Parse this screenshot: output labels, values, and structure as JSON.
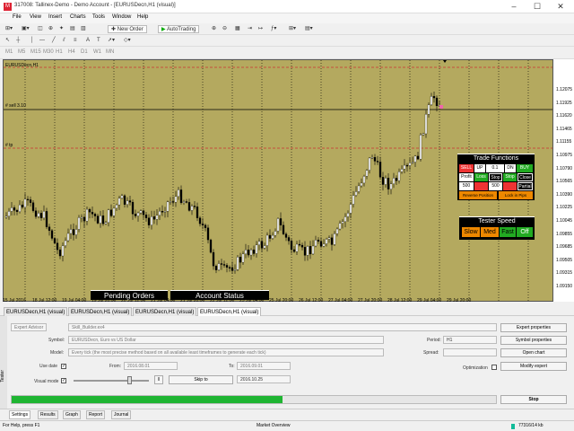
{
  "window": {
    "title": "317008: Tallinex-Demo - Demo Account - [EURUSDecn,H1 (visual)]",
    "logo": "M"
  },
  "menu": [
    "File",
    "View",
    "Insert",
    "Charts",
    "Tools",
    "Window",
    "Help"
  ],
  "toolbar": {
    "new_order": "New Order",
    "autotrading": "AutoTrading"
  },
  "timeframes": [
    "M1",
    "M5",
    "M15",
    "M30",
    "H1",
    "H4",
    "D1",
    "W1",
    "MN"
  ],
  "chart": {
    "symbol_label": "EURUSDecn,H1",
    "sell_label": "# sell 3.10",
    "tp_label": "# tp",
    "price_labels": [
      "1.12075",
      "1.11925",
      "1.11620",
      "1.11465",
      "1.11155",
      "1.10975",
      "1.10790",
      "1.10565",
      "1.10390",
      "1.10225",
      "1.10045",
      "1.09855",
      "1.09685",
      "1.09505",
      "1.09315",
      "1.09150"
    ],
    "time_labels": [
      "15 Jul 2016",
      "18 Jul 12:00",
      "19 Jul 04:00",
      "19 Jul 20:00",
      "20 Jul 12:00",
      "21 Jul 04:00",
      "21 Jul 20:00",
      "22 Jul 12:00",
      "25 Jul 04:00",
      "25 Jul 20:00",
      "26 Jul 12:00",
      "27 Jul 04:00",
      "27 Jul 20:00",
      "28 Jul 12:00",
      "29 Jul 04:00",
      "29 Jul 20:00"
    ],
    "colors": {
      "bg": "#b4a95f",
      "bull": "#ffffff",
      "bear": "#000000",
      "trade_line": "#cc3333"
    }
  },
  "trade_panel": {
    "title": "Trade Functions",
    "row1": {
      "sell": "SELL",
      "up": "UP",
      "lot": "0.1",
      "dn": "DN",
      "buy": "BUY"
    },
    "row2": {
      "profit": "Profit",
      "loss": "Loss",
      "stop": "Stop",
      "stop2": "Stop",
      "close": "Close"
    },
    "row3": {
      "tp": "500",
      "sl": "0",
      "val": "500",
      "val2": "0",
      "partial": "Partial"
    },
    "row4": {
      "reverse": "Reverse Position",
      "lock": "Lock in Pips"
    }
  },
  "speed_panel": {
    "title": "Tester Speed",
    "slow": "Slow",
    "med": "Med",
    "fast": "Fast",
    "off": "Off"
  },
  "bottom_buttons": {
    "pending": "Pending Orders",
    "account": "Account Status"
  },
  "chart_tabs": [
    "EURUSDecn,H1 (visual)",
    "EURUSDecn,H1 (visual)",
    "EURUSDecn,H1 (visual)",
    "EURUSDecn,H1 (visual)"
  ],
  "tester": {
    "type_value": "Expert Advisor",
    "expert_value": "Skill_Builder.ex4",
    "symbol_label": "Symbol:",
    "symbol_value": "EURUSDecn, Euro vs US Dollar",
    "model_label": "Model:",
    "model_value": "Every tick (the most precise method based on all available least timeframes to generate each tick)",
    "use_date_label": "Use date",
    "from_label": "From:",
    "from_value": "2016.08.01",
    "to_label": "To:",
    "to_value": "2016.09.01",
    "visual_label": "Visual mode",
    "skip_label": "Skip to",
    "skip_value": "2016.10.25",
    "period_label": "Period:",
    "period_value": "H1",
    "spread_label": "Spread:",
    "optimization_label": "Optimization",
    "btn_expert_props": "Expert properties",
    "btn_symbol_props": "Symbol properties",
    "btn_open_chart": "Open chart",
    "btn_modify": "Modify expert",
    "btn_stop": "Stop",
    "progress": 0.56,
    "side_label": "Tester"
  },
  "bottom_tabs": [
    "Settings",
    "Results",
    "Graph",
    "Report",
    "Journal"
  ],
  "status": {
    "help": "For Help, press F1",
    "market": "Market Overview",
    "traffic": "77316/14 kb"
  }
}
